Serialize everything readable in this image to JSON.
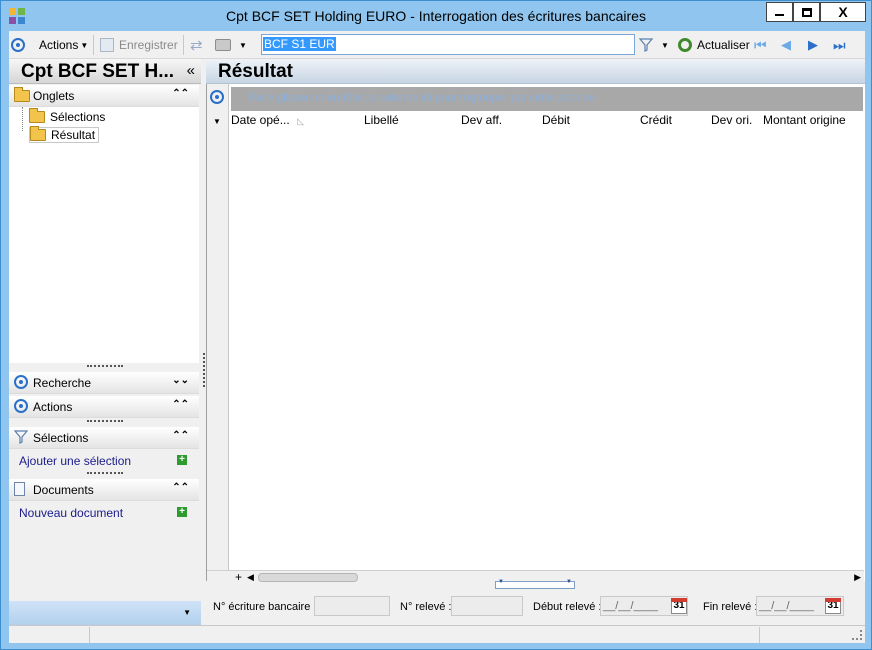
{
  "window": {
    "title": "Cpt BCF SET Holding EURO -  Interrogation des écritures bancaires",
    "min_label": "—",
    "max_label": "□",
    "close_label": "X"
  },
  "toolbar": {
    "actions_label": "Actions",
    "save_label": "Enregistrer",
    "search_value": "BCF S1 EUR",
    "refresh_label": "Actualiser"
  },
  "left_panel": {
    "title": "Cpt BCF SET H...",
    "collapse_glyph": "«",
    "tabs_header": "Onglets",
    "tree": [
      "Sélections",
      "Résultat"
    ],
    "sections": {
      "search": "Recherche",
      "actions": "Actions",
      "selections": "Sélections",
      "add_selection": "Ajouter une sélection",
      "documents": "Documents",
      "new_document": "Nouveau document"
    }
  },
  "main": {
    "title": "Résultat",
    "group_hint": "Faire glisser un en-tête de colonne ici pour regrouper par cette colonne",
    "columns": [
      "Date opé...",
      "Libellé",
      "Dev aff.",
      "Débit",
      "Crédit",
      "Dev ori.",
      "Montant origine"
    ]
  },
  "filters": {
    "bank_entry_label": "N° écriture bancaire :",
    "statement_label": "N° relevé :",
    "start_label": "Début relevé :",
    "start_value": "__/__/____",
    "end_label": "Fin relevé :",
    "end_value": "__/__/____",
    "calendar_day": "31"
  }
}
